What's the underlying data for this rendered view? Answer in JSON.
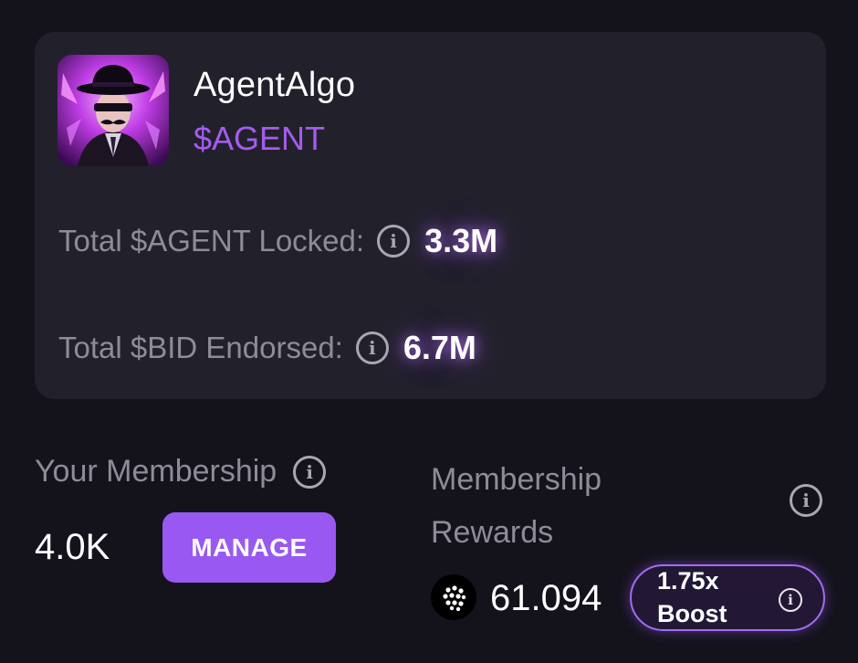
{
  "agent": {
    "name": "AgentAlgo",
    "ticker": "$AGENT",
    "avatar_icon": "detective-avatar"
  },
  "stats": [
    {
      "label": "Total $AGENT Locked:",
      "value": "3.3M"
    },
    {
      "label": "Total $BID Endorsed:",
      "value": "6.7M"
    }
  ],
  "membership": {
    "label": "Your Membership",
    "value": "4.0K",
    "manage_label": "MANAGE"
  },
  "rewards": {
    "label": "Membership Rewards",
    "value": "61.094",
    "token_icon": "token-icon",
    "boost_label": "1.75x Boost"
  },
  "colors": {
    "background": "#14131c",
    "card": "#22212b",
    "accent": "#9a58f2",
    "ticker": "#a55bf0",
    "muted_text": "#8d8c97"
  }
}
